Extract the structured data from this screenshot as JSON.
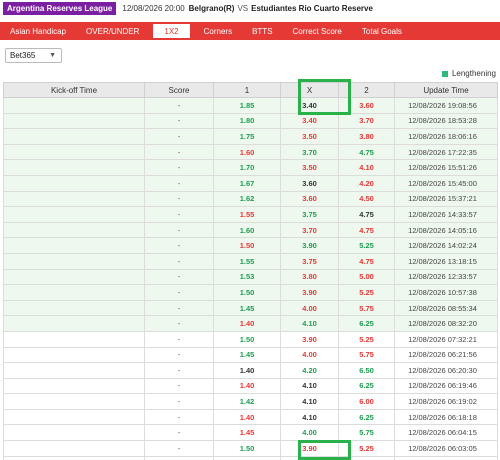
{
  "header": {
    "league": "Argentina Reserves League",
    "date": "12/08/2026 20:00",
    "home_team": "Belgrano(R)",
    "vs": "VS",
    "away_team": "Estudiantes Rio Cuarto Reserve"
  },
  "tabs": [
    {
      "label": "Asian Handicap",
      "active": false
    },
    {
      "label": "OVER/UNDER",
      "active": false
    },
    {
      "label": "1X2",
      "active": true
    },
    {
      "label": "Corners",
      "active": false
    },
    {
      "label": "BTTS",
      "active": false
    },
    {
      "label": "Correct Score",
      "active": false
    },
    {
      "label": "Total Goals",
      "active": false
    }
  ],
  "bookmaker_select": {
    "value": "Bet365"
  },
  "legend": {
    "label": "Lengthening",
    "color": "#2eb87a"
  },
  "table": {
    "headers": [
      "Kick-off Time",
      "Score",
      "1",
      "X",
      "2",
      "Update Time"
    ],
    "rows": [
      {
        "kickoff": "",
        "score": "-",
        "h": "1.85",
        "hc": "green",
        "x": "3.40",
        "xc": "dark",
        "a": "3.60",
        "ac": "red",
        "time": "12/08/2026 19:08:56",
        "hl": true
      },
      {
        "kickoff": "",
        "score": "-",
        "h": "1.80",
        "hc": "green",
        "x": "3.40",
        "xc": "red",
        "a": "3.70",
        "ac": "red",
        "time": "12/08/2026 18:53:28",
        "hl": true
      },
      {
        "kickoff": "",
        "score": "-",
        "h": "1.75",
        "hc": "green",
        "x": "3.50",
        "xc": "red",
        "a": "3.80",
        "ac": "red",
        "time": "12/08/2026 18:06:16",
        "hl": true
      },
      {
        "kickoff": "",
        "score": "-",
        "h": "1.60",
        "hc": "red",
        "x": "3.70",
        "xc": "green",
        "a": "4.75",
        "ac": "green",
        "time": "12/08/2026 17:22:35",
        "hl": true
      },
      {
        "kickoff": "",
        "score": "-",
        "h": "1.70",
        "hc": "green",
        "x": "3.50",
        "xc": "red",
        "a": "4.10",
        "ac": "red",
        "time": "12/08/2026 15:51:26",
        "hl": true
      },
      {
        "kickoff": "",
        "score": "-",
        "h": "1.67",
        "hc": "green",
        "x": "3.60",
        "xc": "dark",
        "a": "4.20",
        "ac": "red",
        "time": "12/08/2026 15:45:00",
        "hl": true
      },
      {
        "kickoff": "",
        "score": "-",
        "h": "1.62",
        "hc": "green",
        "x": "3.60",
        "xc": "red",
        "a": "4.50",
        "ac": "red",
        "time": "12/08/2026 15:37:21",
        "hl": true
      },
      {
        "kickoff": "",
        "score": "-",
        "h": "1.55",
        "hc": "red",
        "x": "3.75",
        "xc": "green",
        "a": "4.75",
        "ac": "dark",
        "time": "12/08/2026 14:33:57",
        "hl": true
      },
      {
        "kickoff": "",
        "score": "-",
        "h": "1.60",
        "hc": "green",
        "x": "3.70",
        "xc": "red",
        "a": "4.75",
        "ac": "red",
        "time": "12/08/2026 14:05:16",
        "hl": true
      },
      {
        "kickoff": "",
        "score": "-",
        "h": "1.50",
        "hc": "red",
        "x": "3.90",
        "xc": "green",
        "a": "5.25",
        "ac": "green",
        "time": "12/08/2026 14:02:24",
        "hl": true
      },
      {
        "kickoff": "",
        "score": "-",
        "h": "1.55",
        "hc": "green",
        "x": "3.75",
        "xc": "red",
        "a": "4.75",
        "ac": "red",
        "time": "12/08/2026 13:18:15",
        "hl": true
      },
      {
        "kickoff": "",
        "score": "-",
        "h": "1.53",
        "hc": "green",
        "x": "3.80",
        "xc": "red",
        "a": "5.00",
        "ac": "red",
        "time": "12/08/2026 12:33:57",
        "hl": true
      },
      {
        "kickoff": "",
        "score": "-",
        "h": "1.50",
        "hc": "green",
        "x": "3.90",
        "xc": "red",
        "a": "5.25",
        "ac": "red",
        "time": "12/08/2026 10:57:38",
        "hl": true
      },
      {
        "kickoff": "",
        "score": "-",
        "h": "1.45",
        "hc": "green",
        "x": "4.00",
        "xc": "red",
        "a": "5.75",
        "ac": "red",
        "time": "12/08/2026 08:55:34",
        "hl": true
      },
      {
        "kickoff": "",
        "score": "-",
        "h": "1.40",
        "hc": "red",
        "x": "4.10",
        "xc": "green",
        "a": "6.25",
        "ac": "green",
        "time": "12/08/2026 08:32:20",
        "hl": true
      },
      {
        "kickoff": "",
        "score": "-",
        "h": "1.50",
        "hc": "green",
        "x": "3.90",
        "xc": "red",
        "a": "5.25",
        "ac": "red",
        "time": "12/08/2026 07:32:21",
        "hl": false
      },
      {
        "kickoff": "",
        "score": "-",
        "h": "1.45",
        "hc": "green",
        "x": "4.00",
        "xc": "red",
        "a": "5.75",
        "ac": "red",
        "time": "12/08/2026 06:21:56",
        "hl": false
      },
      {
        "kickoff": "",
        "score": "-",
        "h": "1.40",
        "hc": "dark",
        "x": "4.20",
        "xc": "green",
        "a": "6.50",
        "ac": "green",
        "time": "12/08/2026 06:20:30",
        "hl": false
      },
      {
        "kickoff": "",
        "score": "-",
        "h": "1.40",
        "hc": "red",
        "x": "4.10",
        "xc": "dark",
        "a": "6.25",
        "ac": "green",
        "time": "12/08/2026 06:19:46",
        "hl": false
      },
      {
        "kickoff": "",
        "score": "-",
        "h": "1.42",
        "hc": "green",
        "x": "4.10",
        "xc": "dark",
        "a": "6.00",
        "ac": "red",
        "time": "12/08/2026 06:19:02",
        "hl": false
      },
      {
        "kickoff": "",
        "score": "-",
        "h": "1.40",
        "hc": "red",
        "x": "4.10",
        "xc": "dark",
        "a": "6.25",
        "ac": "green",
        "time": "12/08/2026 06:18:18",
        "hl": false
      },
      {
        "kickoff": "",
        "score": "-",
        "h": "1.45",
        "hc": "red",
        "x": "4.00",
        "xc": "green",
        "a": "5.75",
        "ac": "green",
        "time": "12/08/2026 06:04:15",
        "hl": false
      },
      {
        "kickoff": "",
        "score": "-",
        "h": "1.50",
        "hc": "green",
        "x": "3.90",
        "xc": "red",
        "a": "5.25",
        "ac": "red",
        "time": "12/08/2026 06:03:05",
        "hl": false
      },
      {
        "kickoff": "",
        "score": "-",
        "h": "1.40",
        "hc": "red",
        "x": "4.10",
        "xc": "dark",
        "a": "6.25",
        "ac": "green",
        "time": "12/08/2026 05:22:17",
        "hl": false
      }
    ]
  },
  "colors": {
    "green": "#1e9e50",
    "red": "#e53935",
    "tabbar": "#e53935",
    "league": "#7a1fa2",
    "highlight_box": "#29b24a"
  }
}
